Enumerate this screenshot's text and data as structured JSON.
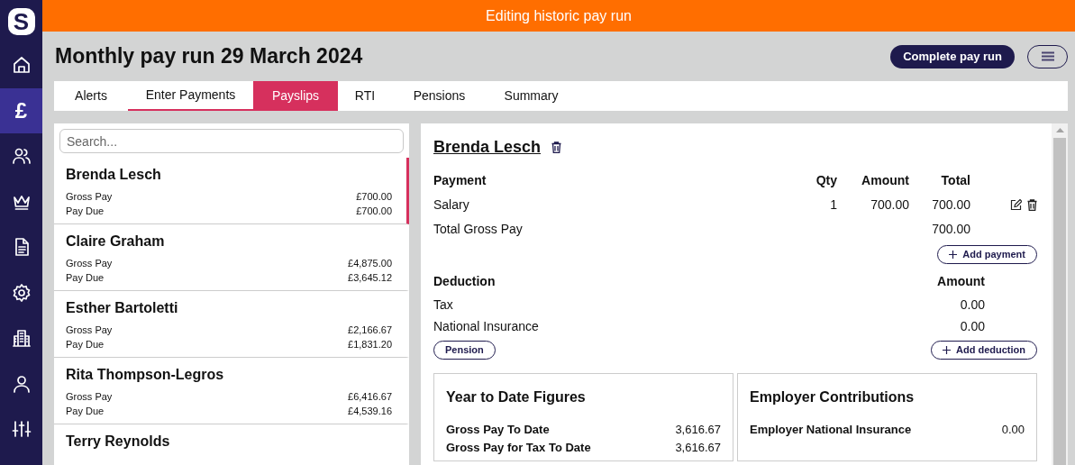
{
  "sidebar": {
    "logo": "S",
    "items": [
      {
        "kind": "home",
        "selected": false
      },
      {
        "kind": "glyph",
        "glyph": "£",
        "selected": true
      },
      {
        "kind": "people",
        "selected": false
      },
      {
        "kind": "crown",
        "selected": false
      },
      {
        "kind": "document",
        "selected": false
      },
      {
        "kind": "settings",
        "selected": false
      },
      {
        "kind": "building",
        "selected": false
      },
      {
        "kind": "person",
        "selected": false
      },
      {
        "kind": "sliders",
        "selected": false
      }
    ]
  },
  "banner": "Editing historic pay run",
  "header": {
    "title": "Monthly pay run 29 March 2024",
    "primary_button": "Complete pay run"
  },
  "tabs": [
    {
      "label": "Alerts",
      "selected": false,
      "underlined": false
    },
    {
      "label": "Enter Payments",
      "selected": false,
      "underlined": true
    },
    {
      "label": "Payslips",
      "selected": true,
      "underlined": false
    },
    {
      "label": "RTI",
      "selected": false,
      "underlined": false
    },
    {
      "label": "Pensions",
      "selected": false,
      "underlined": false
    },
    {
      "label": "Summary",
      "selected": false,
      "underlined": false
    }
  ],
  "employees": {
    "search": {
      "placeholder": "Search..."
    },
    "items": [
      {
        "name": "Brenda Lesch",
        "selected": true,
        "lines": [
          [
            "Gross Pay",
            "£700.00"
          ],
          [
            "Pay Due",
            "£700.00"
          ]
        ]
      },
      {
        "name": "Claire Graham",
        "selected": false,
        "lines": [
          [
            "Gross Pay",
            "£4,875.00"
          ],
          [
            "Pay Due",
            "£3,645.12"
          ]
        ]
      },
      {
        "name": "Esther Bartoletti",
        "selected": false,
        "lines": [
          [
            "Gross Pay",
            "£2,166.67"
          ],
          [
            "Pay Due",
            "£1,831.20"
          ]
        ]
      },
      {
        "name": "Rita Thompson-Legros",
        "selected": false,
        "lines": [
          [
            "Gross Pay",
            "£6,416.67"
          ],
          [
            "Pay Due",
            "£4,539.16"
          ]
        ]
      },
      {
        "name": "Terry Reynolds",
        "selected": false
      }
    ]
  },
  "payslip": {
    "name": "Brenda Lesch",
    "payments": {
      "columns": [
        "Payment",
        "Qty",
        "Amount",
        "Total"
      ],
      "rows": [
        {
          "label": "Salary",
          "qty": "1",
          "amount": "700.00",
          "total": "700.00"
        }
      ],
      "total_label": "Total Gross Pay",
      "total": "700.00",
      "add_button": "Add payment"
    },
    "deductions": {
      "columns": [
        "Deduction",
        "Amount"
      ],
      "rows": [
        {
          "label": "Tax",
          "amount": "0.00"
        },
        {
          "label": "National Insurance",
          "amount": "0.00"
        }
      ],
      "pension_button": "Pension",
      "add_button": "Add deduction"
    },
    "ytd": {
      "title": "Year to Date Figures",
      "rows": [
        [
          "Gross Pay To Date",
          "3,616.67"
        ],
        [
          "Gross Pay for Tax To Date",
          "3,616.67"
        ]
      ]
    },
    "employer": {
      "title": "Employer Contributions",
      "rows": [
        [
          "Employer National Insurance",
          "0.00"
        ]
      ]
    }
  }
}
